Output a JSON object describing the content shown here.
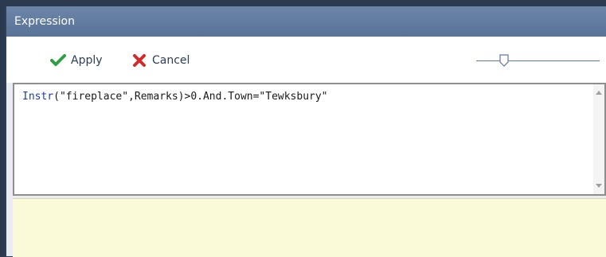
{
  "window": {
    "title": "Expression"
  },
  "toolbar": {
    "apply_label": "Apply",
    "cancel_label": "Cancel",
    "apply_icon": "check-icon",
    "cancel_icon": "x-icon",
    "apply_icon_color": "#2ea043",
    "cancel_icon_color": "#d12b2b"
  },
  "zoom_slider": {
    "level": 0.2
  },
  "editor": {
    "function_name": "Instr",
    "rest_of_expression": "(\"fireplace\",Remarks)>0.And.Town=\"Tewksbury\""
  },
  "colors": {
    "titlebar": "#5f7b9e",
    "results_background": "#fafad8",
    "keyword": "#1a3ea8"
  }
}
